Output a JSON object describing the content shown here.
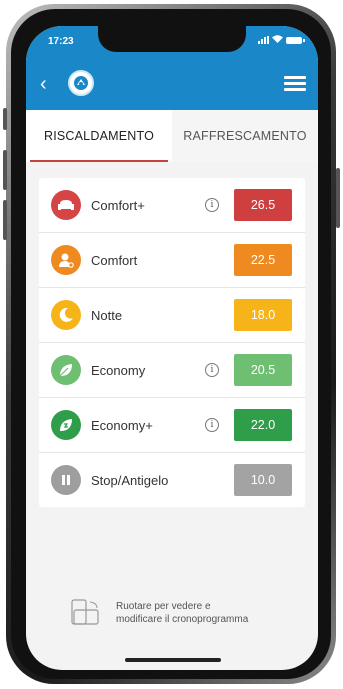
{
  "status_bar": {
    "time": "17:23"
  },
  "header": {
    "back_symbol": "‹",
    "logo": "logo-icon",
    "menu": "menu-icon"
  },
  "tabs": [
    {
      "label": "RISCALDAMENTO",
      "active": true
    },
    {
      "label": "RAFFRESCAMENTO",
      "active": false
    }
  ],
  "modes": [
    {
      "label": "Comfort+",
      "value": "26.5",
      "info": true,
      "color": "#cf3f3f",
      "icon_color": "#d64545",
      "icon": "armchair-icon"
    },
    {
      "label": "Comfort",
      "value": "22.5",
      "info": false,
      "color": "#ee8a1f",
      "icon_color": "#ee8a1f",
      "icon": "person-icon"
    },
    {
      "label": "Notte",
      "value": "18.0",
      "info": false,
      "color": "#f7b419",
      "icon_color": "#f7b419",
      "icon": "moon-icon"
    },
    {
      "label": "Economy",
      "value": "20.5",
      "info": true,
      "color": "#6fbf73",
      "icon_color": "#6fbf73",
      "icon": "leaf-icon"
    },
    {
      "label": "Economy+",
      "value": "22.0",
      "info": true,
      "color": "#2f9e4a",
      "icon_color": "#2f9e4a",
      "icon": "leaf-plus-icon"
    },
    {
      "label": "Stop/Antigelo",
      "value": "10.0",
      "info": false,
      "color": "#a3a3a3",
      "icon_color": "#9e9e9e",
      "icon": "pause-icon"
    }
  ],
  "rotate_hint": {
    "line1": "Ruotare per vedere e",
    "line2": "modificare il cronoprogramma"
  }
}
